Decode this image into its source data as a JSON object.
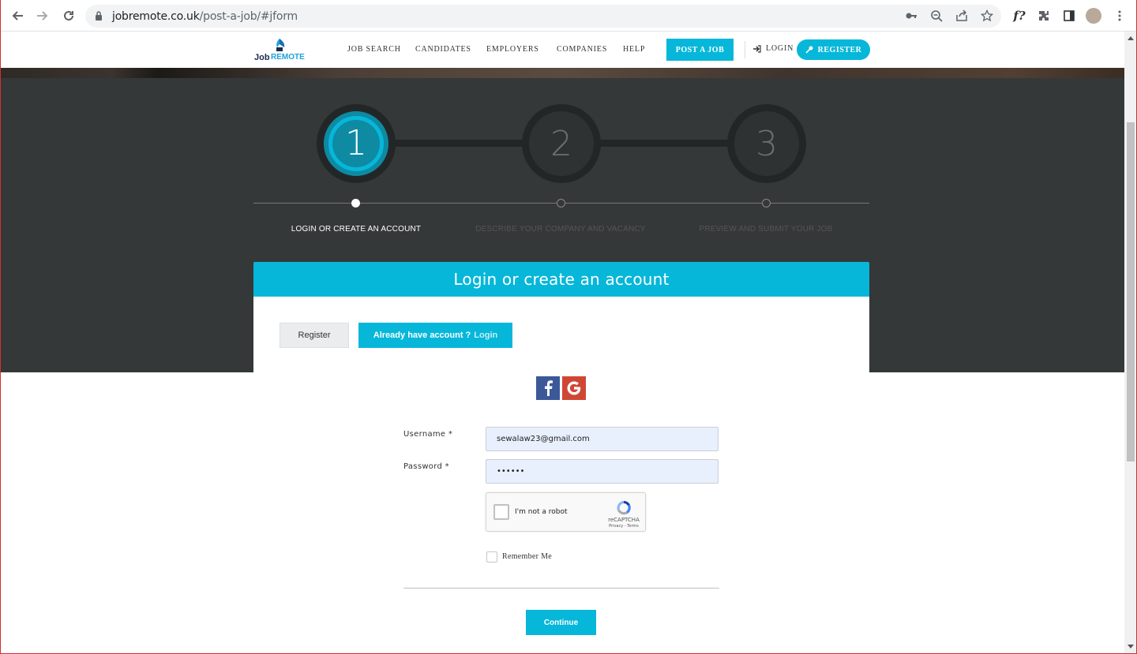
{
  "browser": {
    "url_host": "jobremote.co.uk",
    "url_path": "/post-a-job/#jform",
    "icons": [
      "back-icon",
      "forward-icon",
      "reload-icon",
      "lock-icon",
      "key-icon",
      "zoom-icon",
      "share-icon",
      "star-icon",
      "fonts-extension-icon",
      "extensions-icon",
      "side-panel-icon",
      "profile-avatar",
      "menu-icon"
    ],
    "fonts_extension_label": "f?"
  },
  "header": {
    "logo_job": "Job",
    "logo_remote": "REMOTE",
    "menu": [
      "JOB SEARCH",
      "CANDIDATES",
      "EMPLOYERS",
      "COMPANIES",
      "HELP"
    ],
    "post_job": "POST A JOB",
    "login": "LOGIN",
    "register": "REGISTER"
  },
  "steps": [
    {
      "number": "1",
      "label": "LOGIN OR CREATE AN ACCOUNT",
      "active": true
    },
    {
      "number": "2",
      "label": "DESCRIBE YOUR COMPANY AND VACANCY",
      "active": false
    },
    {
      "number": "3",
      "label": "PREVIEW AND SUBMIT YOUR JOB",
      "active": false
    }
  ],
  "panel": {
    "title": "Login or create an account",
    "tab_register": "Register",
    "tab_login_prefix": "Already have account ?",
    "tab_login_link": "Login"
  },
  "social": {
    "facebook": "f",
    "google": "G"
  },
  "form": {
    "username_label": "Username  *",
    "username_value": "sewalaw23@gmail.com",
    "password_label": "Password *",
    "password_value": "••••••",
    "captcha_text": "I'm not a robot",
    "captcha_brand": "reCAPTCHA",
    "captcha_terms": "Privacy - Terms",
    "remember_label": "Remember Me",
    "continue": "Continue"
  },
  "colors": {
    "accent": "#06b7d9",
    "dark_bg": "#353839",
    "facebook": "#3b5998",
    "google": "#d04635"
  }
}
